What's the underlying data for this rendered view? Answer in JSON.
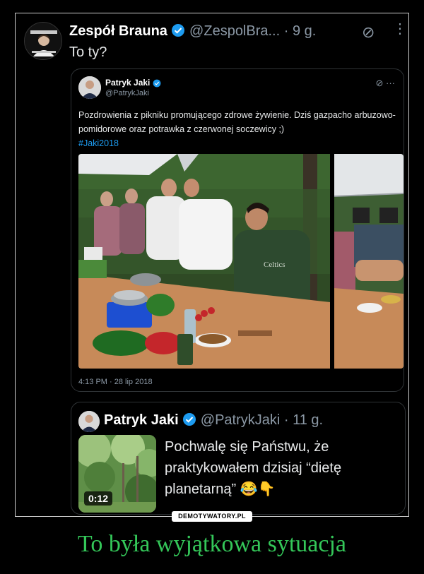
{
  "tweet": {
    "author_name": "Zespół Brauna",
    "handle": "@ZespolBra...",
    "time": "· 9 g.",
    "text": "To ty?"
  },
  "quote1": {
    "author_name": "Patryk Jaki",
    "handle": "@PatrykJaki",
    "text": "Pozdrowienia z pikniku promującego zdrowe żywienie. Dziś gazpacho arbuzowo-pomidorowe oraz potrawka z czerwonej soczewicy ;)",
    "hashtag": "#Jaki2018",
    "more": "···",
    "date": "4:13 PM · 28 lip 2018",
    "shirt_text": "Celtics"
  },
  "quote2": {
    "author_name": "Patryk Jaki",
    "handle": "@PatrykJaki",
    "time": "· 11 g.",
    "text": "Pochwalę się Państwu, że praktykowałem dzisiaj “dietę planetarną” 😂👇",
    "video_duration": "0:12"
  },
  "footer": {
    "badge": "DEMOTYWATORY.PL",
    "caption": "To była wyjątkowa sytuacja"
  },
  "colors": {
    "background": "#000000",
    "verified": "#1d9bf0",
    "caption": "#34c759",
    "muted": "#8b98a5"
  },
  "icons": [
    "verified-badge-icon",
    "no-sign-icon",
    "more-icon"
  ]
}
